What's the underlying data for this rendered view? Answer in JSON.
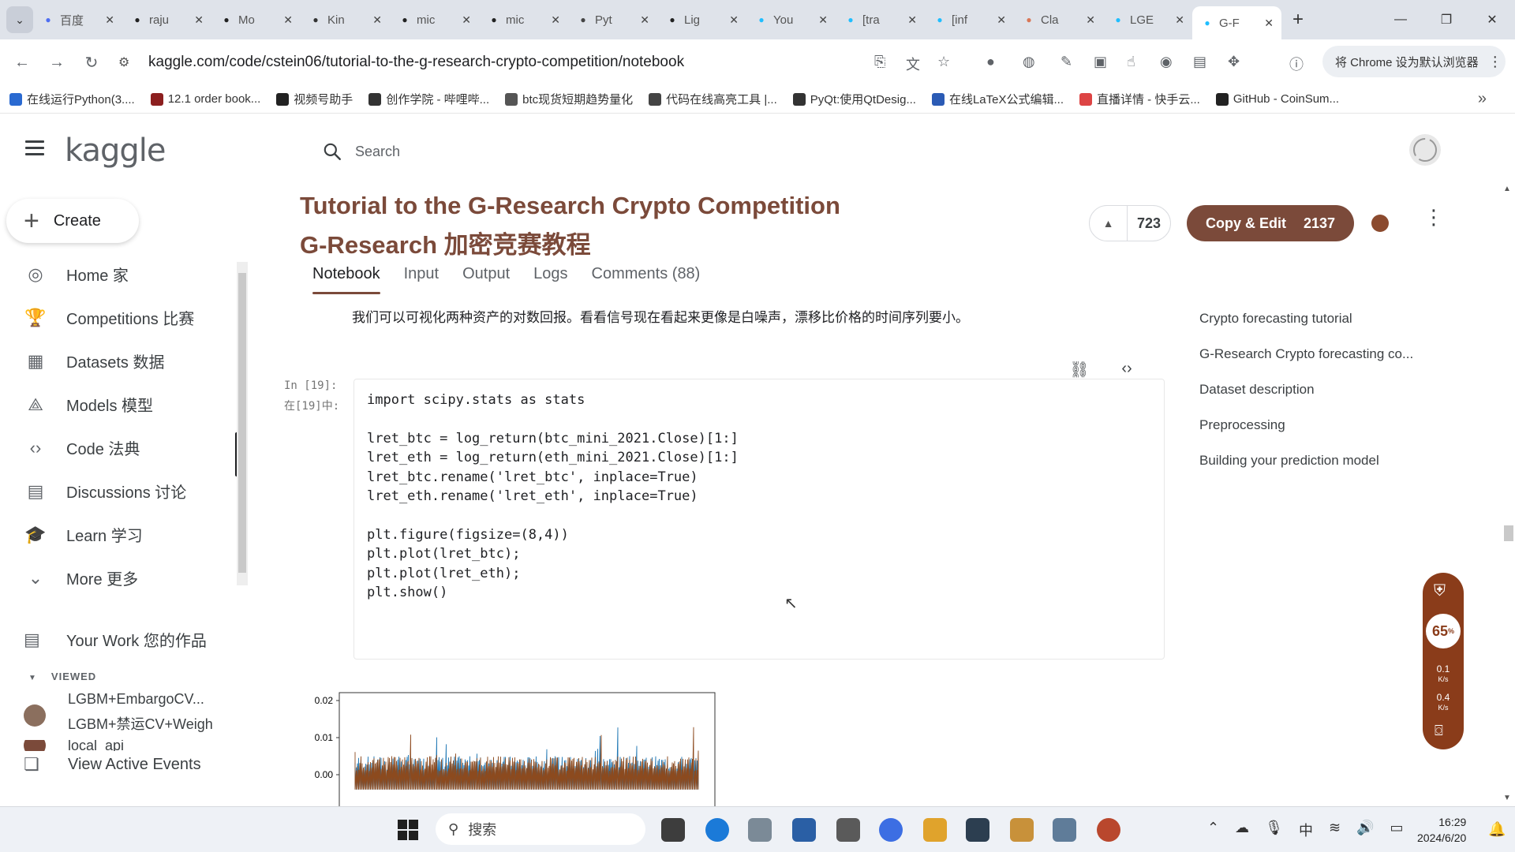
{
  "browser": {
    "tabs": [
      {
        "title": "百度",
        "icon": "baidu-icon",
        "color": "#4e6ef2"
      },
      {
        "title": "raju",
        "icon": "github-icon",
        "color": "#222222"
      },
      {
        "title": "Mo",
        "icon": "github-icon",
        "color": "#222222"
      },
      {
        "title": "Kin",
        "icon": "k-icon",
        "color": "#333333"
      },
      {
        "title": "mic",
        "icon": "github-icon",
        "color": "#222222"
      },
      {
        "title": "mic",
        "icon": "github-icon",
        "color": "#222222"
      },
      {
        "title": "Pyt",
        "icon": "python-icon",
        "color": "#444444"
      },
      {
        "title": "Lig",
        "icon": "github-icon",
        "color": "#222222"
      },
      {
        "title": "You",
        "icon": "kaggle-k-icon",
        "color": "#20beff"
      },
      {
        "title": "[tra",
        "icon": "kaggle-k-icon",
        "color": "#20beff"
      },
      {
        "title": "[inf",
        "icon": "kaggle-k-icon",
        "color": "#20beff"
      },
      {
        "title": "Cla",
        "icon": "claude-icon",
        "color": "#d97757"
      },
      {
        "title": "LGE",
        "icon": "kaggle-k-icon",
        "color": "#20beff"
      },
      {
        "title": "G-F",
        "icon": "kaggle-k-icon",
        "color": "#20beff",
        "active": true
      }
    ],
    "url": "kaggle.com/code/cstein06/tutorial-to-the-g-research-crypto-competition/notebook",
    "set_default": "将 Chrome 设为默认浏览器",
    "bookmarks": [
      "在线运行Python(3....",
      "12.1 order book...",
      "视频号助手",
      "创作学院 - 哔哩哔...",
      "btc现货短期趋势量化",
      "代码在线高亮工具 |...",
      "PyQt:使用QtDesig...",
      "在线LaTeX公式编辑...",
      "直播详情 - 快手云...",
      "GitHub - CoinSum..."
    ]
  },
  "kaggle": {
    "logo": "kaggle",
    "search_placeholder": "Search",
    "create": "Create",
    "nav": [
      {
        "label": "Home 家",
        "icon": "compass-icon"
      },
      {
        "label": "Competitions 比赛",
        "icon": "trophy-icon"
      },
      {
        "label": "Datasets 数据",
        "icon": "table-icon"
      },
      {
        "label": "Models 模型",
        "icon": "models-icon"
      },
      {
        "label": "Code 法典",
        "icon": "code-icon",
        "active": true
      },
      {
        "label": "Discussions 讨论",
        "icon": "comments-icon"
      },
      {
        "label": "Learn 学习",
        "icon": "school-icon"
      },
      {
        "label": "More 更多",
        "icon": "chevron-down-icon"
      }
    ],
    "your_work": "Your Work 您的作品",
    "viewed_header": "VIEWED",
    "viewed": [
      "LGBM+EmbargoCV...",
      "LGBM+禁运CV+Weigh",
      "local_api"
    ],
    "view_events": "View Active Events"
  },
  "notebook": {
    "title_en": "Tutorial to the G-Research Crypto Competition",
    "title_cn": "G-Research 加密竞赛教程",
    "upvotes": "723",
    "copy_edit": "Copy & Edit",
    "copy_count": "2137",
    "tabs": [
      "Notebook",
      "Input",
      "Output",
      "Logs",
      "Comments (88)"
    ],
    "intro_cn": "我们可以可视化两种资产的对数回报。看看信号现在看起来更像是白噪声，漂移比价格的时间序列要小。",
    "cell_label_en": "In [19]:",
    "cell_label_cn": "在[19]中:",
    "code": "import scipy.stats as stats\n\nlret_btc = log_return(btc_mini_2021.Close)[1:]\nlret_eth = log_return(eth_mini_2021.Close)[1:]\nlret_btc.rename('lret_btc', inplace=True)\nlret_eth.rename('lret_eth', inplace=True)\n\nplt.figure(figsize=(8,4))\nplt.plot(lret_btc);\nplt.plot(lret_eth);\nplt.show()",
    "toc": [
      "Crypto forecasting tutorial",
      "G-Research Crypto forecasting co...",
      "Dataset description",
      "Preprocessing",
      "Building your prediction model"
    ]
  },
  "chart_data": {
    "type": "line",
    "yticks": [
      "0.02",
      "0.01",
      "0.00"
    ],
    "ylim": [
      0.0,
      0.02
    ],
    "series": [
      {
        "color": "#1f77b4"
      },
      {
        "color": "#8c4a1e"
      }
    ]
  },
  "widget": {
    "percent": "65",
    "up_speed": "0.1",
    "down_speed": "0.4",
    "unit": "K/s"
  },
  "taskbar": {
    "search": "搜索",
    "time": "16:29",
    "date": "2024/6/20",
    "ime": "中"
  }
}
